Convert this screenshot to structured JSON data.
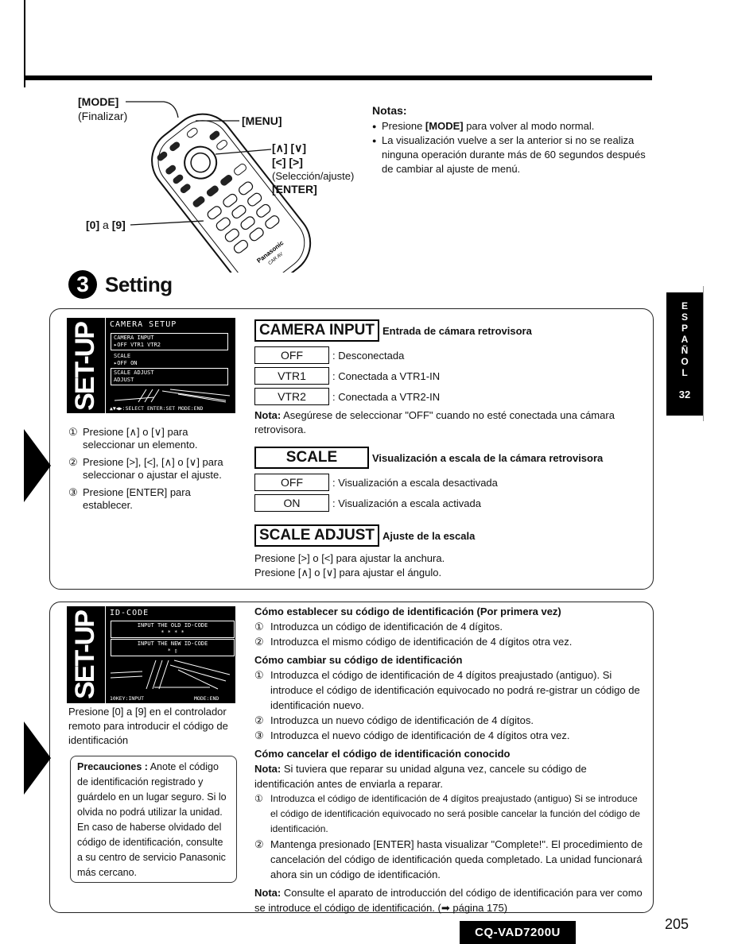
{
  "remote_diagram": {
    "labels": {
      "mode": "[MODE]",
      "mode_sub": "(Finalizar)",
      "menu": "[MENU]",
      "updown": "[∧] [∨]",
      "leftright": "[<] [>]",
      "select_sub": "(Selección/ajuste)",
      "enter": "[ENTER]",
      "digits_key": "[0]",
      "digits_mid": "a",
      "digits_key2": "[9]"
    },
    "brand": "Panasonic",
    "brand_sub": "CAR AV"
  },
  "notes": {
    "title": "Notas:",
    "items": [
      {
        "pre": "Presione ",
        "bold": "[MODE]",
        "post": " para volver al modo normal."
      },
      {
        "pre": "La visualización vuelve a ser la anterior si no se realiza ninguna operación durante más de 60 segundos después de cambiar al ajuste de menú.",
        "bold": "",
        "post": ""
      }
    ]
  },
  "section": {
    "number": "3",
    "title": "Setting"
  },
  "camera_setup_screen": {
    "band": "SET-UP",
    "title": "CAMERA SETUP",
    "rows": [
      {
        "label": "CAMERA INPUT",
        "value": "▸OFF  VTR1  VTR2"
      },
      {
        "label": "SCALE",
        "value": "▸OFF  ON"
      },
      {
        "label": "SCALE ADJUST",
        "value": "ADJUST"
      }
    ],
    "footer": "▲▼◀▶:SELECT   ENTER:SET   MODE:END"
  },
  "steps": [
    {
      "num": "①",
      "text": "Presione [∧] o [∨] para seleccionar un elemento."
    },
    {
      "num": "②",
      "text": "Presione [>], [<], [∧] o [∨] para seleccionar o ajustar el ajuste."
    },
    {
      "num": "③",
      "text": "Presione [ENTER] para establecer."
    }
  ],
  "camera_input": {
    "header": "CAMERA INPUT",
    "desc": "Entrada de cámara retrovisora",
    "options": [
      {
        "value": "OFF",
        "desc": ": Desconectada"
      },
      {
        "value": "VTR1",
        "desc": ": Conectada a VTR1-IN"
      },
      {
        "value": "VTR2",
        "desc": ": Conectada a VTR2-IN"
      }
    ],
    "note_label": "Nota:",
    "note_text": " Asegúrese de seleccionar \"OFF\" cuando no esté conectada una cámara retrovisora."
  },
  "scale": {
    "header": "SCALE",
    "desc": "Visualización a escala de la cámara retrovisora",
    "options": [
      {
        "value": "OFF",
        "desc": ": Visualización a escala desactivada"
      },
      {
        "value": "ON",
        "desc": ": Visualización a escala activada"
      }
    ]
  },
  "scale_adjust": {
    "header": "SCALE ADJUST",
    "desc": "Ajuste de la escala",
    "lines": [
      "Presione [>] o [<] para ajustar la anchura.",
      "Presione [∧] o [∨] para ajustar el ángulo."
    ]
  },
  "id_code_screen": {
    "band": "SET-UP",
    "title": "ID-CODE",
    "box1": "INPUT THE OLD ID-CODE",
    "box1_value": "* * * *",
    "box2": "INPUT THE NEW ID-CODE",
    "box2_value": "* ▯",
    "footer_left": "10KEY:INPUT",
    "footer_right": "MODE:END"
  },
  "id_intro": "Presione [0] a [9] en el controlador remoto para introducir el código de identificación",
  "precaution": {
    "label": "Precauciones :",
    "text": " Anote el código de identificación registrado y guárdelo en un lugar seguro. Si lo olvida no podrá utilizar la unidad. En caso de haberse olvidado del código de identificación, consulte a su centro de servicio Panasonic más cercano."
  },
  "id_sections": [
    {
      "title": "Cómo establecer su código de identificación (Por primera vez)",
      "note": null,
      "items": [
        {
          "num": "①",
          "text": "Introduzca un código de identificación de 4 dígitos."
        },
        {
          "num": "②",
          "text": "Introduzca el mismo código de identificación de 4 dígitos otra vez."
        }
      ]
    },
    {
      "title": "Cómo cambiar su código de identificación",
      "note": null,
      "items": [
        {
          "num": "①",
          "text": "Introduzca el código de identificación de 4 dígitos preajustado (antiguo). Si introduce el código de identificación equivocado no podrá re-gistrar un código de identificación nuevo."
        },
        {
          "num": "②",
          "text": "Introduzca un nuevo código de identificación de 4 dígitos."
        },
        {
          "num": "③",
          "text": "Introduzca el nuevo código de identificación de 4 dígitos otra vez."
        }
      ]
    },
    {
      "title": "Cómo cancelar el código de identificación conocido",
      "note": {
        "label": "Nota:",
        "text": " Si tuviera que reparar su unidad alguna vez, cancele su código de identificación antes de enviarla a reparar."
      },
      "items": [
        {
          "num": "①",
          "text": "Introduzca el código de identificación de 4 dígitos preajustado (antiguo) Si se introduce el código de identificación equivocado no será posible cancelar la función del código de identificación."
        },
        {
          "num": "②",
          "text": "Mantenga presionado [ENTER] hasta visualizar \"Complete!\". El procedimiento de cancelación del código de identificación queda completado. La unidad funcionará ahora sin un código de identificación."
        }
      ]
    }
  ],
  "final_note": {
    "label": "Nota:",
    "text": " Consulte el aparato de introducción del código de identificación para ver como se introduce el código de identificación. (➡ página 175)"
  },
  "side_tab": {
    "letters": [
      "E",
      "S",
      "P",
      "A",
      "Ñ",
      "O",
      "L"
    ],
    "number": "32"
  },
  "footer": {
    "model": "CQ-VAD7200U",
    "page": "205"
  }
}
